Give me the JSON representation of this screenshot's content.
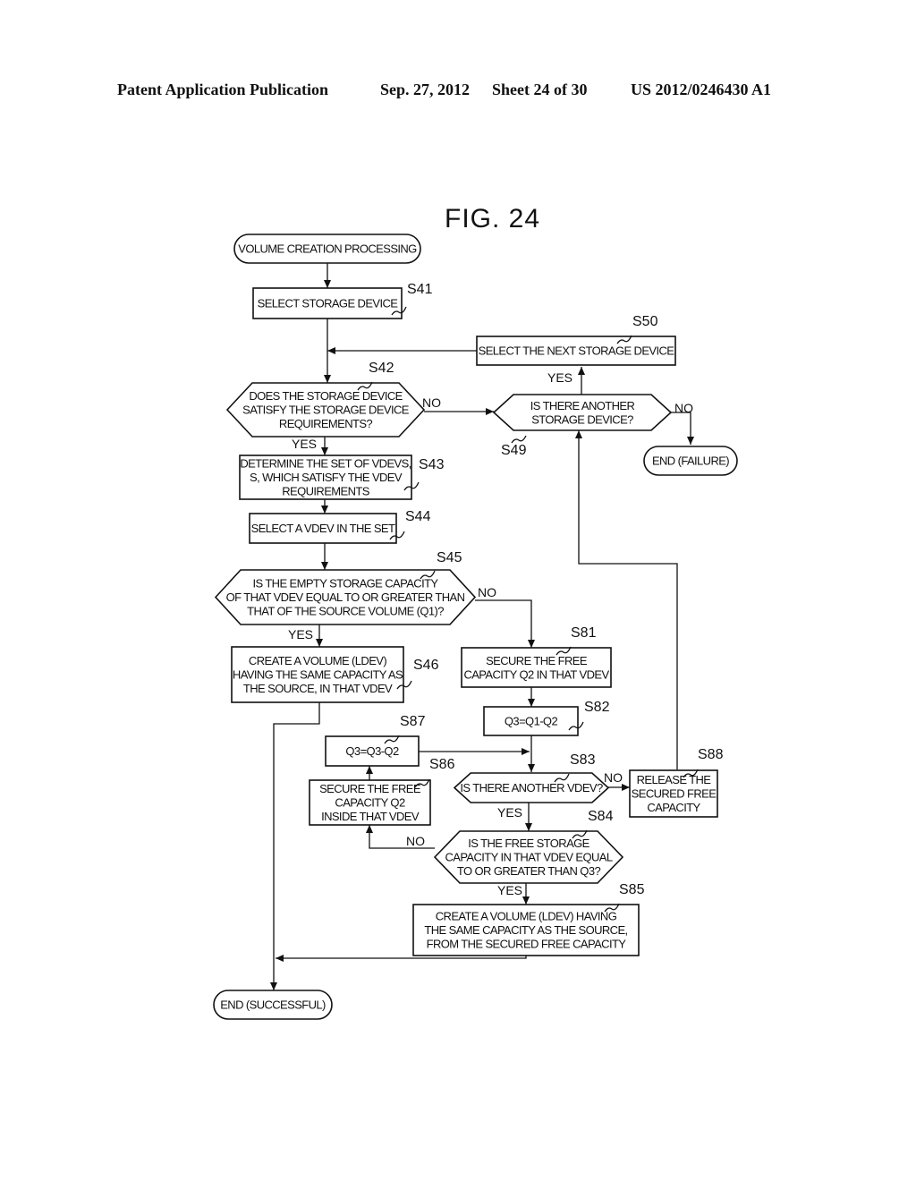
{
  "header": {
    "publication": "Patent Application Publication",
    "date": "Sep. 27, 2012",
    "sheet": "Sheet 24 of 30",
    "number": "US 2012/0246430 A1"
  },
  "figure": {
    "title": "FIG. 24"
  },
  "nodes": {
    "start": {
      "lines": [
        "VOLUME CREATION PROCESSING"
      ]
    },
    "s41": {
      "label": "S41",
      "lines": [
        "SELECT STORAGE DEVICE"
      ]
    },
    "s42": {
      "label": "S42",
      "lines": [
        "DOES THE STORAGE DEVICE",
        "SATISFY THE STORAGE DEVICE",
        "REQUIREMENTS?"
      ]
    },
    "s43": {
      "label": "S43",
      "lines": [
        "DETERMINE THE SET OF VDEVS,",
        "S, WHICH SATISFY THE VDEV",
        "REQUIREMENTS"
      ]
    },
    "s44": {
      "label": "S44",
      "lines": [
        "SELECT A VDEV IN THE SET"
      ]
    },
    "s45": {
      "label": "S45",
      "lines": [
        "IS THE EMPTY STORAGE CAPACITY",
        "OF THAT VDEV EQUAL TO OR GREATER THAN",
        "THAT OF THE SOURCE VOLUME (Q1)?"
      ]
    },
    "s46": {
      "label": "S46",
      "lines": [
        "CREATE A VOLUME (LDEV)",
        "HAVING THE SAME CAPACITY AS",
        "THE SOURCE, IN THAT VDEV"
      ]
    },
    "s49": {
      "label": "S49",
      "lines": [
        "IS THERE ANOTHER",
        "STORAGE DEVICE?"
      ]
    },
    "s50": {
      "label": "S50",
      "lines": [
        "SELECT THE NEXT STORAGE DEVICE"
      ]
    },
    "end_failure": {
      "lines": [
        "END (FAILURE)"
      ]
    },
    "s81": {
      "label": "S81",
      "lines": [
        "SECURE THE FREE",
        "CAPACITY Q2 IN THAT VDEV"
      ]
    },
    "s82": {
      "label": "S82",
      "lines": [
        "Q3=Q1-Q2"
      ]
    },
    "s83": {
      "label": "S83",
      "lines": [
        "IS THERE ANOTHER VDEV?"
      ]
    },
    "s84": {
      "label": "S84",
      "lines": [
        "IS THE FREE STORAGE",
        "CAPACITY IN THAT VDEV EQUAL",
        "TO OR GREATER THAN Q3?"
      ]
    },
    "s85": {
      "label": "S85",
      "lines": [
        "CREATE A VOLUME (LDEV) HAVING",
        "THE SAME CAPACITY AS THE SOURCE,",
        "FROM THE SECURED FREE CAPACITY"
      ]
    },
    "s86": {
      "label": "S86",
      "lines": [
        "SECURE THE FREE",
        "CAPACITY Q2",
        "INSIDE THAT VDEV"
      ]
    },
    "s87": {
      "label": "S87",
      "lines": [
        "Q3=Q3-Q2"
      ]
    },
    "s88": {
      "label": "S88",
      "lines": [
        "RELEASE THE",
        "SECURED FREE",
        "CAPACITY"
      ]
    },
    "end_success": {
      "lines": [
        "END (SUCCESSFUL)"
      ]
    }
  },
  "branches": {
    "yes": "YES",
    "no": "NO"
  }
}
